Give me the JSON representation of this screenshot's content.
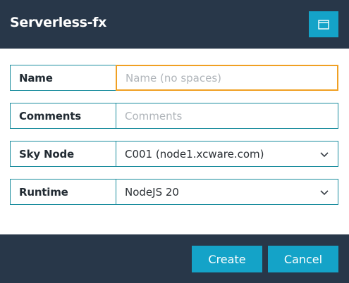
{
  "dialog": {
    "title": "Serverless-fx",
    "maximize_icon": "window-maximize-icon"
  },
  "form": {
    "name": {
      "label": "Name",
      "value": "",
      "placeholder": "Name (no spaces)"
    },
    "comments": {
      "label": "Comments",
      "value": "",
      "placeholder": "Comments"
    },
    "sky_node": {
      "label": "Sky Node",
      "selected": "C001 (node1.xcware.com)"
    },
    "runtime": {
      "label": "Runtime",
      "selected": "NodeJS 20"
    }
  },
  "footer": {
    "create_label": "Create",
    "cancel_label": "Cancel"
  },
  "colors": {
    "header_bg": "#283749",
    "accent": "#14a3c8",
    "border": "#1b8d9e",
    "focus": "#f0a023"
  }
}
